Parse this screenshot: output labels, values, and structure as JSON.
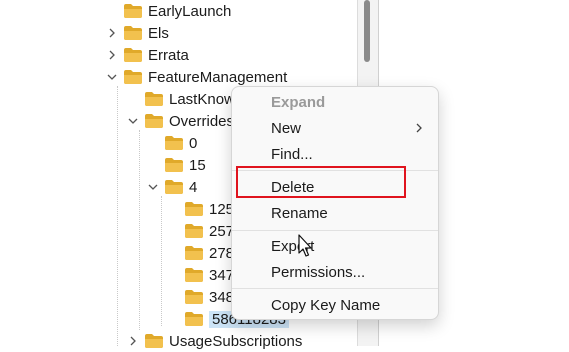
{
  "tree": {
    "items": [
      {
        "label": "EarlyLaunch",
        "expander": "none"
      },
      {
        "label": "Els",
        "expander": "collapsed"
      },
      {
        "label": "Errata",
        "expander": "collapsed"
      },
      {
        "label": "FeatureManagement",
        "expander": "expanded"
      },
      {
        "label": "LastKnow",
        "expander": "none"
      },
      {
        "label": "Overrides",
        "expander": "expanded"
      },
      {
        "label": "0",
        "expander": "none"
      },
      {
        "label": "15",
        "expander": "none"
      },
      {
        "label": "4",
        "expander": "expanded"
      },
      {
        "label": "125",
        "expander": "none"
      },
      {
        "label": "257",
        "expander": "none"
      },
      {
        "label": "278",
        "expander": "none"
      },
      {
        "label": "347",
        "expander": "none"
      },
      {
        "label": "348",
        "expander": "none"
      },
      {
        "label": "586118283",
        "expander": "none",
        "selected": true
      },
      {
        "label": "UsageSubscriptions",
        "expander": "collapsed"
      }
    ]
  },
  "context_menu": {
    "items": [
      {
        "label": "Expand",
        "state": "disabled"
      },
      {
        "label": "New",
        "submenu": true
      },
      {
        "label": "Find..."
      },
      {
        "label": "Delete",
        "annotated": true
      },
      {
        "label": "Rename"
      },
      {
        "label": "Export"
      },
      {
        "label": "Permissions..."
      },
      {
        "label": "Copy Key Name"
      }
    ]
  },
  "colors": {
    "folder": "#f2c14e",
    "folder_dark": "#e0a92a",
    "highlight_box": "#e0141e",
    "selection": "#cce4f7"
  },
  "icons": {
    "folder": "folder-icon",
    "expand": "chevron-right-icon",
    "collapse": "chevron-down-icon",
    "submenu": "chevron-right-icon",
    "pointer": "mouse-cursor-icon"
  }
}
